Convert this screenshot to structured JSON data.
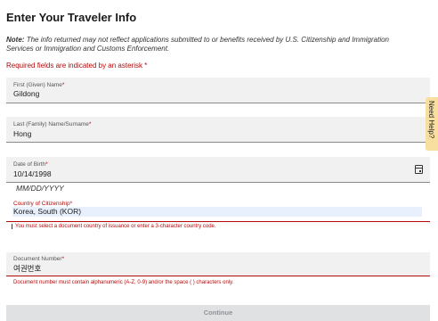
{
  "page": {
    "title": "Enter Your Traveler Info",
    "note_label": "Note:",
    "note_text": "The info returned may not reflect applications submitted to or benefits received by U.S. Citizenship and Immigration Services or Immigration and Customs Enforcement.",
    "required_notice": "Required fields are indicated by an asterisk *"
  },
  "fields": {
    "first_name": {
      "label": "First (Given) Name",
      "required_mark": "*",
      "value": "Gildong"
    },
    "last_name": {
      "label": "Last (Family) Name/Surname",
      "required_mark": "*",
      "value": "Hong"
    },
    "dob": {
      "label": "Date of Birth",
      "required_mark": "*",
      "value": "10/14/1998",
      "hint": "MM/DD/YYYY"
    },
    "citizenship": {
      "label": "Country of Citizenship",
      "required_mark": "*",
      "value": "Korea, South (KOR)",
      "error": "You must select a document country of issuance or enter a 3-character country code."
    },
    "document_number": {
      "label": "Document Number",
      "required_mark": "*",
      "value": "여권번호",
      "error": "Document number must contain alphanumeric (A-Z, 0-9) and/or the space ( ) characters only."
    }
  },
  "actions": {
    "continue_label": "Continue"
  },
  "help_tab": {
    "label": "Need Help?"
  },
  "colors": {
    "error": "#b50909",
    "field_bg": "#f1f1f1",
    "help_tab_bg": "#f8dfa0",
    "autofill_bg": "#e8f0fe",
    "disabled_button": "#dfe1e2"
  },
  "icons": {
    "date_picker": "calendar-icon"
  }
}
